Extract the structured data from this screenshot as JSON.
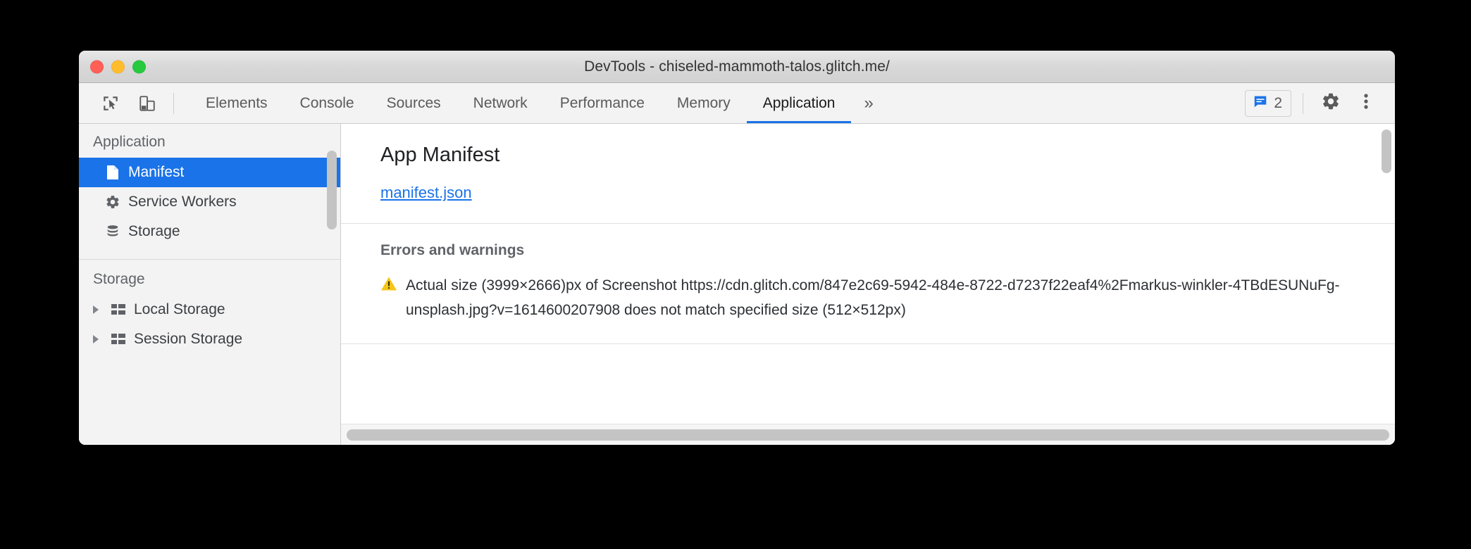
{
  "window": {
    "title": "DevTools - chiseled-mammoth-talos.glitch.me/",
    "traffic_lights": {
      "close_label": "close",
      "minimize_label": "minimize",
      "maximize_label": "maximize",
      "close_color": "#ff5f56",
      "minimize_color": "#ffbd2e",
      "maximize_color": "#27c93f"
    }
  },
  "toolbar": {
    "inspect_icon": "inspect-element-icon",
    "device_icon": "device-toolbar-icon",
    "tabs": [
      {
        "label": "Elements",
        "active": false
      },
      {
        "label": "Console",
        "active": false
      },
      {
        "label": "Sources",
        "active": false
      },
      {
        "label": "Network",
        "active": false
      },
      {
        "label": "Performance",
        "active": false
      },
      {
        "label": "Memory",
        "active": false
      },
      {
        "label": "Application",
        "active": true
      }
    ],
    "more_tabs_label": "»",
    "message_badge": {
      "icon": "message-icon",
      "count": "2",
      "color": "#1a73e8"
    },
    "settings_icon": "gear-icon",
    "menu_icon": "kebab-menu-icon"
  },
  "sidebar": {
    "groups": [
      {
        "title": "Application",
        "items": [
          {
            "label": "Manifest",
            "icon": "document-icon",
            "selected": true,
            "expandable": false
          },
          {
            "label": "Service Workers",
            "icon": "gear-icon",
            "selected": false,
            "expandable": false
          },
          {
            "label": "Storage",
            "icon": "database-icon",
            "selected": false,
            "expandable": false
          }
        ]
      },
      {
        "title": "Storage",
        "items": [
          {
            "label": "Local Storage",
            "icon": "table-icon",
            "selected": false,
            "expandable": true
          },
          {
            "label": "Session Storage",
            "icon": "table-icon",
            "selected": false,
            "expandable": true
          }
        ]
      }
    ],
    "selection_color": "#1a73e8"
  },
  "main": {
    "panel_title": "App Manifest",
    "manifest_link": "manifest.json",
    "errors_heading": "Errors and warnings",
    "warning": {
      "icon": "warning-triangle-icon",
      "color": "#f5c518",
      "text": "Actual size (3999×2666)px of Screenshot https://cdn.glitch.com/847e2c69-5942-484e-8722-d7237f22eaf4%2Fmarkus-winkler-4TBdESUNuFg-unsplash.jpg?v=1614600207908 does not match specified size (512×512px)"
    }
  }
}
